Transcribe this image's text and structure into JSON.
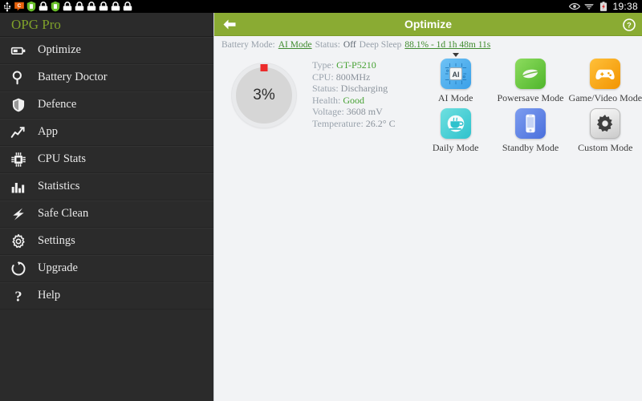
{
  "statusbar": {
    "clock": "19:38",
    "left_icons": [
      {
        "name": "usb-icon"
      },
      {
        "name": "chat-bubble-icon"
      },
      {
        "name": "shield-icon"
      },
      {
        "name": "lock-icon"
      },
      {
        "name": "shield-icon"
      },
      {
        "name": "lock-icon"
      },
      {
        "name": "lock-icon"
      },
      {
        "name": "lock-icon"
      },
      {
        "name": "lock-icon"
      },
      {
        "name": "lock-icon"
      },
      {
        "name": "lock-icon"
      }
    ],
    "right_icons": [
      {
        "name": "eye-icon"
      },
      {
        "name": "wifi-icon"
      },
      {
        "name": "battery-alert-icon"
      }
    ]
  },
  "sidebar": {
    "brand": "OPG Pro",
    "items": [
      {
        "label": "Optimize",
        "icon": "battery-icon"
      },
      {
        "label": "Battery Doctor",
        "icon": "magnifier-icon"
      },
      {
        "label": "Defence",
        "icon": "shield-icon"
      },
      {
        "label": "App",
        "icon": "trend-chart-icon"
      },
      {
        "label": "CPU Stats",
        "icon": "cpu-chip-icon"
      },
      {
        "label": "Statistics",
        "icon": "bar-chart-icon"
      },
      {
        "label": "Safe Clean",
        "icon": "lightning-bolt-icon"
      },
      {
        "label": "Settings",
        "icon": "gear-icon"
      },
      {
        "label": "Upgrade",
        "icon": "refresh-circle-icon"
      },
      {
        "label": "Help",
        "icon": "question-mark-icon"
      }
    ]
  },
  "appbar": {
    "title": "Optimize",
    "back_icon": "back-arrow-icon",
    "help_icon": "help-circle-icon",
    "accent_color": "#8aab33"
  },
  "infobar": {
    "battery_mode_label": "Battery Mode:",
    "battery_mode_value": "AI Mode",
    "status_label": "Status:",
    "status_value": "Off",
    "deep_sleep_label": "Deep Sleep",
    "deep_sleep_value": "88.1% - 1d 1h 48m 11s",
    "link_color": "#3f8b2e"
  },
  "battery": {
    "percent": "3%",
    "percent_value": 3,
    "indicator_color": "#ec2b2b",
    "stats": [
      {
        "key": "Type:",
        "value": "GT-P5210",
        "green": true
      },
      {
        "key": "CPU:",
        "value": "800MHz",
        "green": false
      },
      {
        "key": "Status:",
        "value": "Discharging",
        "green": false
      },
      {
        "key": "Health:",
        "value": "Good",
        "green": true
      },
      {
        "key": "Voltage:",
        "value": "3608 mV",
        "green": false
      },
      {
        "key": "Temperature:",
        "value": "26.2° C",
        "green": false
      }
    ]
  },
  "modes": {
    "selected": "AI Mode",
    "items": [
      {
        "label": "AI Mode",
        "icon": "ai-chip-icon",
        "style": "ico-ai",
        "selected": true
      },
      {
        "label": "Powersave Mode",
        "icon": "leaf-icon",
        "style": "ico-power",
        "selected": false
      },
      {
        "label": "Game/Video Mode",
        "icon": "gamepad-icon",
        "style": "ico-game",
        "selected": false
      },
      {
        "label": "Daily Mode",
        "icon": "coffee-cup-icon",
        "style": "ico-daily",
        "selected": false
      },
      {
        "label": "Standby Mode",
        "icon": "phone-icon",
        "style": "ico-standby",
        "selected": false
      },
      {
        "label": "Custom Mode",
        "icon": "gear-icon",
        "style": "ico-custom",
        "selected": false
      }
    ]
  }
}
